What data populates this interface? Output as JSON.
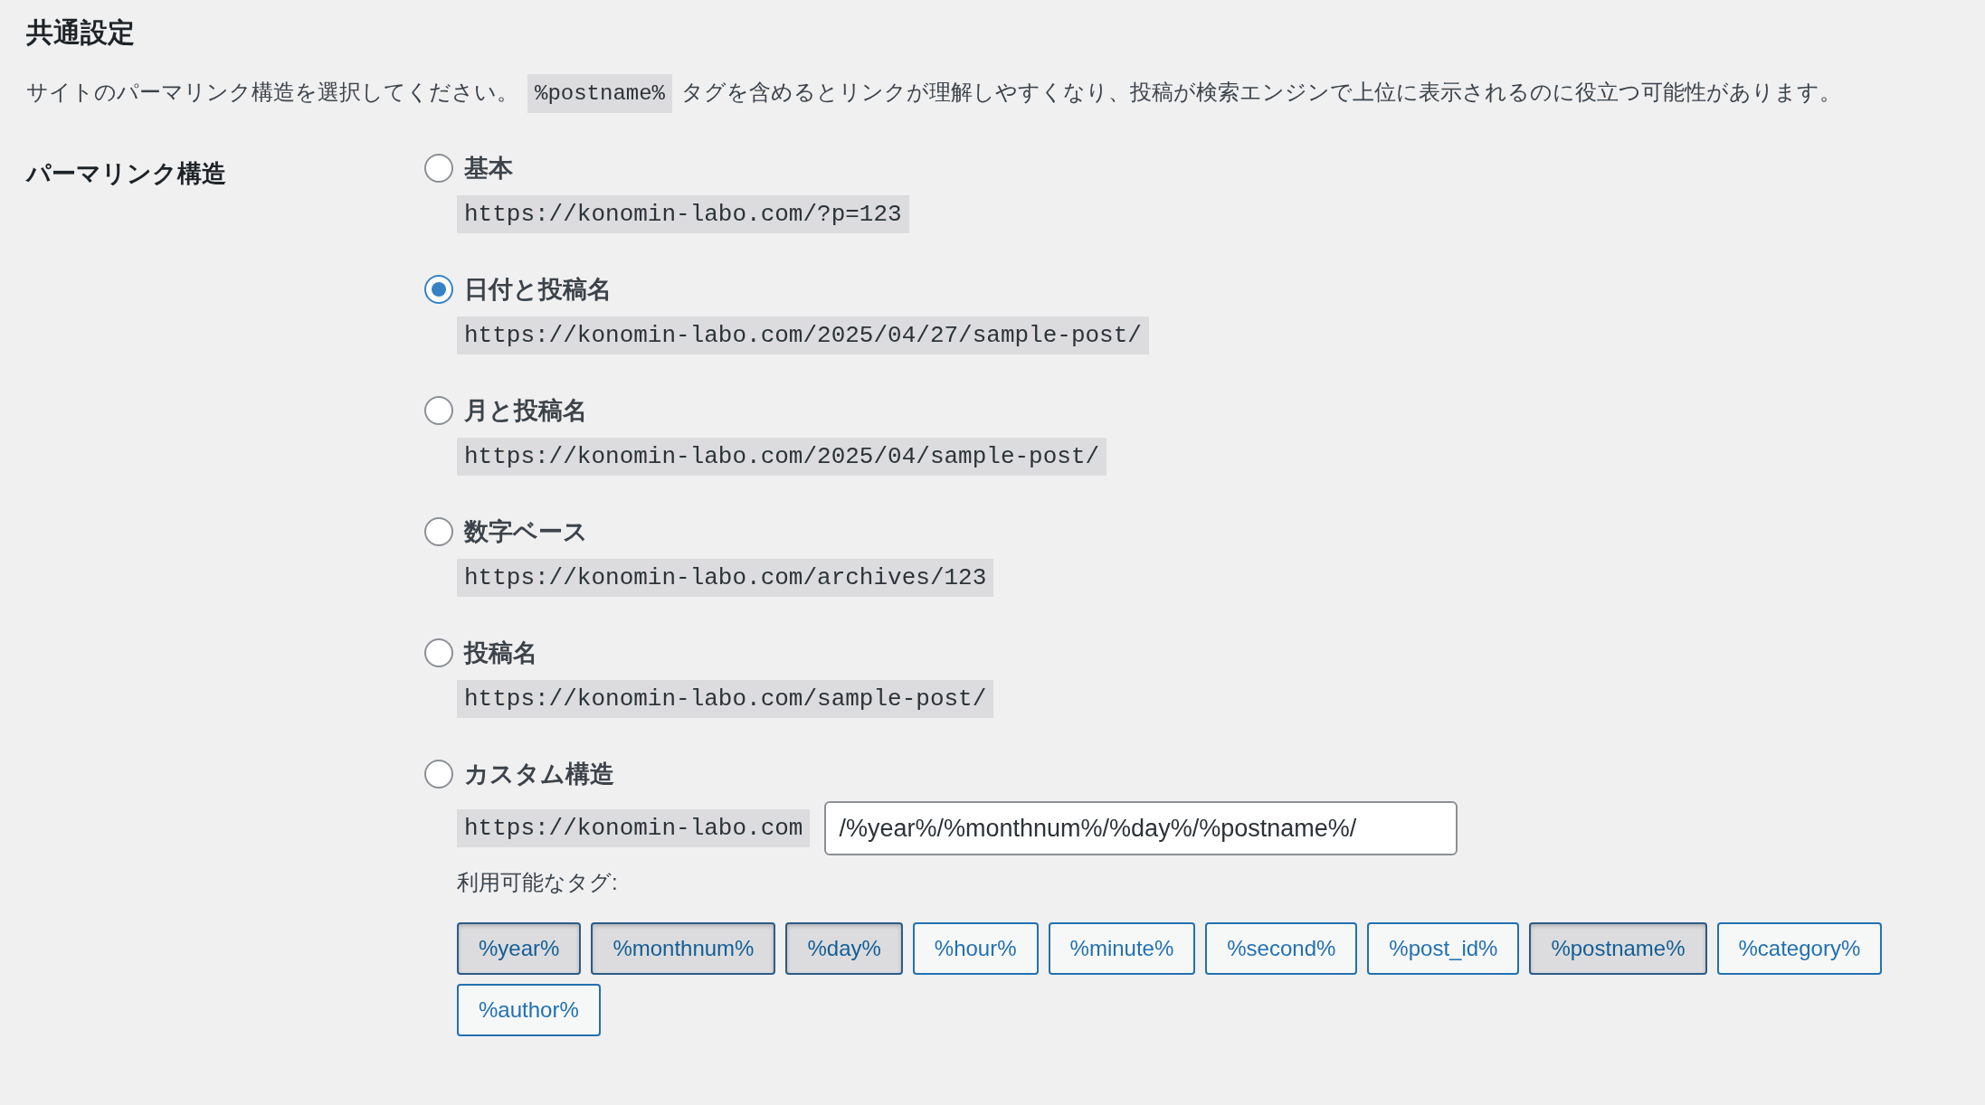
{
  "heading": "共通設定",
  "description": {
    "before": "サイトのパーマリンク構造を選択してください。",
    "code": "%postname%",
    "after": "タグを含めるとリンクが理解しやすくなり、投稿が検索エンジンで上位に表示されるのに役立つ可能性があります。"
  },
  "section_label": "パーマリンク構造",
  "options": [
    {
      "kind": "preset",
      "label": "基本",
      "selected": false,
      "example": "https://konomin-labo.com/?p=123"
    },
    {
      "kind": "preset",
      "label": "日付と投稿名",
      "selected": true,
      "example": "https://konomin-labo.com/2025/04/27/sample-post/"
    },
    {
      "kind": "preset",
      "label": "月と投稿名",
      "selected": false,
      "example": "https://konomin-labo.com/2025/04/sample-post/"
    },
    {
      "kind": "preset",
      "label": "数字ベース",
      "selected": false,
      "example": "https://konomin-labo.com/archives/123"
    },
    {
      "kind": "preset",
      "label": "投稿名",
      "selected": false,
      "example": "https://konomin-labo.com/sample-post/"
    },
    {
      "kind": "custom",
      "label": "カスタム構造",
      "selected": false,
      "example": "https://konomin-labo.com",
      "value": "/%year%/%monthnum%/%day%/%postname%/"
    }
  ],
  "tags_label": "利用可能なタグ:",
  "tags": [
    {
      "label": "%year%",
      "selected": true
    },
    {
      "label": "%monthnum%",
      "selected": true
    },
    {
      "label": "%day%",
      "selected": true
    },
    {
      "label": "%hour%",
      "selected": false
    },
    {
      "label": "%minute%",
      "selected": false
    },
    {
      "label": "%second%",
      "selected": false
    },
    {
      "label": "%post_id%",
      "selected": false
    },
    {
      "label": "%postname%",
      "selected": true
    },
    {
      "label": "%category%",
      "selected": false
    },
    {
      "label": "%author%",
      "selected": false
    }
  ]
}
